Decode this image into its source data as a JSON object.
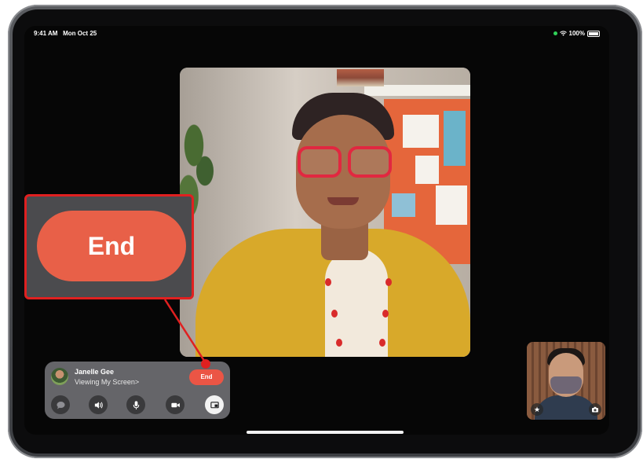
{
  "status_bar": {
    "time": "9:41 AM",
    "date": "Mon Oct 25",
    "battery": "100%"
  },
  "call_panel": {
    "caller_name": "Janelle Gee",
    "caller_status": "Viewing My Screen",
    "end_label": "End",
    "controls": [
      {
        "name": "messages-icon"
      },
      {
        "name": "speaker-icon"
      },
      {
        "name": "microphone-icon"
      },
      {
        "name": "camera-icon"
      },
      {
        "name": "share-screen-icon"
      }
    ]
  },
  "callout": {
    "label": "End"
  },
  "colors": {
    "end_red": "#eb5545",
    "callout_border": "#e02020"
  }
}
